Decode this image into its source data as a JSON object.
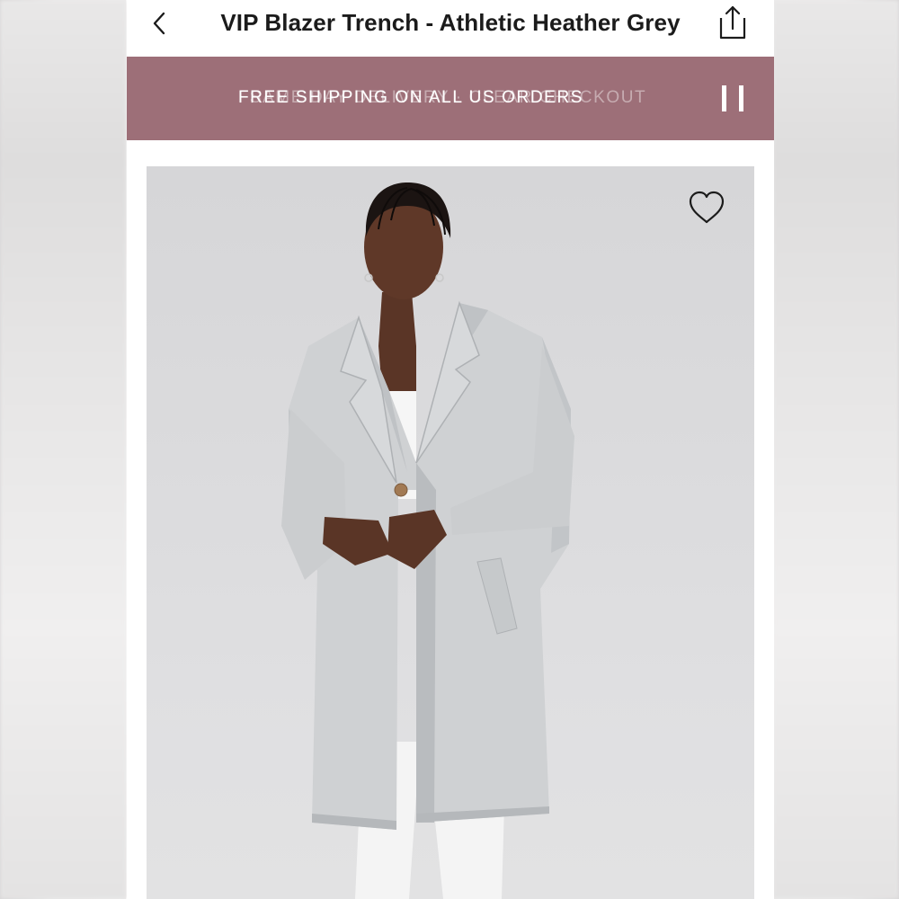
{
  "header": {
    "title": "VIP Blazer Trench - Athletic Heather Grey",
    "back_icon": "chevron-left-icon",
    "share_icon": "share-icon"
  },
  "promo": {
    "message_current": "FREE SHIPPING ON ALL US ORDERS",
    "message_fading": "SAME DAY DELIVERY · CLEAR CHECKOUT",
    "pause_icon": "pause-icon",
    "background": "#9d6f78",
    "text_color": "#ffffff"
  },
  "product": {
    "wishlist_icon": "heart-outline-icon",
    "image_alt": "Model wearing grey knee-length coat over white outfit",
    "background": "#d9d9db"
  },
  "colors": {
    "coat": "#cfd1d3",
    "coat_shadow": "#b9bcbf",
    "skin": "#5a3526",
    "button": "#a27a54"
  }
}
